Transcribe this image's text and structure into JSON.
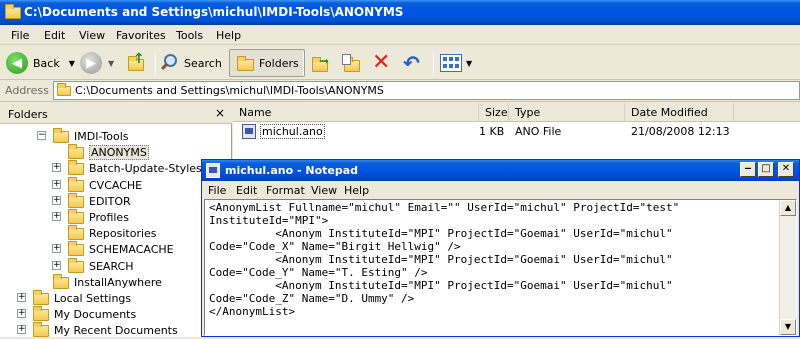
{
  "explorer": {
    "title": "C:\\Documents and Settings\\michul\\IMDI-Tools\\ANONYMS",
    "menu": [
      "File",
      "Edit",
      "View",
      "Favorites",
      "Tools",
      "Help"
    ],
    "toolbar": {
      "back_label": "Back",
      "search_label": "Search",
      "folders_label": "Folders"
    },
    "address": {
      "label": "Address",
      "value": "C:\\Documents and Settings\\michul\\IMDI-Tools\\ANONYMS"
    }
  },
  "folders_pane": {
    "title": "Folders",
    "close_glyph": "×",
    "tree": [
      {
        "label": "IMDI-Tools",
        "expander": "−",
        "indent": 1
      },
      {
        "label": "ANONYMS",
        "expander": "",
        "indent": 2,
        "selected": true
      },
      {
        "label": "Batch-Update-Stylesheets",
        "expander": "+",
        "indent": 2
      },
      {
        "label": "CVCACHE",
        "expander": "+",
        "indent": 2
      },
      {
        "label": "EDITOR",
        "expander": "+",
        "indent": 2
      },
      {
        "label": "Profiles",
        "expander": "+",
        "indent": 2
      },
      {
        "label": "Repositories",
        "expander": "",
        "indent": 2
      },
      {
        "label": "SCHEMACACHE",
        "expander": "+",
        "indent": 2
      },
      {
        "label": "SEARCH",
        "expander": "+",
        "indent": 2
      },
      {
        "label": "InstallAnywhere",
        "expander": "",
        "indent": 1
      },
      {
        "label": "Local Settings",
        "expander": "+",
        "indent": 0
      },
      {
        "label": "My Documents",
        "expander": "+",
        "indent": 0
      },
      {
        "label": "My Recent Documents",
        "expander": "+",
        "indent": 0
      }
    ]
  },
  "file_list": {
    "columns": {
      "name": "Name",
      "size": "Size",
      "type": "Type",
      "modified": "Date Modified"
    },
    "rows": [
      {
        "name": "michul.ano",
        "size": "1 KB",
        "type": "ANO File",
        "modified": "21/08/2008 12:13"
      }
    ]
  },
  "notepad": {
    "title": "michul.ano - Notepad",
    "menu": [
      "File",
      "Edit",
      "Format",
      "View",
      "Help"
    ],
    "content": "<AnonymList Fullname=\"michul\" Email=\"\" UserId=\"michul\" ProjectId=\"test\"\nInstituteId=\"MPI\">\n          <Anonym InstituteId=\"MPI\" ProjectId=\"Goemai\" UserId=\"michul\"\nCode=\"Code_X\" Name=\"Birgit Hellwig\" />\n          <Anonym InstituteId=\"MPI\" ProjectId=\"Goemai\" UserId=\"michul\"\nCode=\"Code_Y\" Name=\"T. Esting\" />\n          <Anonym InstituteId=\"MPI\" ProjectId=\"Goemai\" UserId=\"michul\"\nCode=\"Code_Z\" Name=\"D. Ummy\" />\n</AnonymList>"
  }
}
